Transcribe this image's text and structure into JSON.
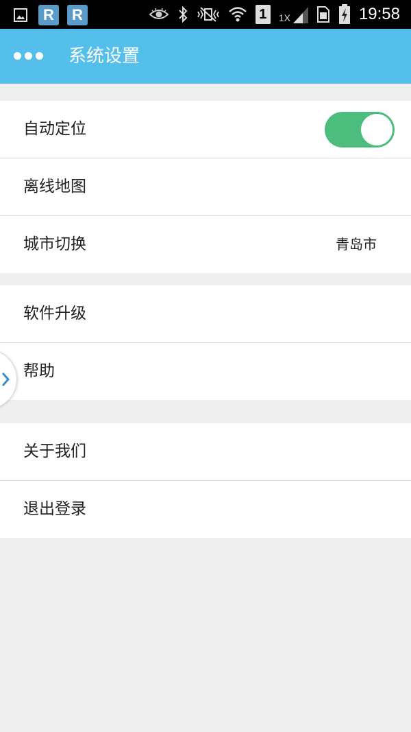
{
  "status_bar": {
    "time": "19:58",
    "sim_slot": "1",
    "network_label": "1X",
    "app_icon_letters": [
      "R",
      "R"
    ],
    "icons": [
      "gallery-icon",
      "r-app-icon",
      "eye-icon",
      "bluetooth-icon",
      "mute-vibrate-icon",
      "wifi-icon",
      "sim-icon",
      "signal-icon",
      "sim-card-icon",
      "battery-charging-icon"
    ]
  },
  "header": {
    "title": "系统设置",
    "menu_icon": "more-dots-icon"
  },
  "groups": [
    {
      "items": [
        {
          "label": "自动定位",
          "control": "toggle",
          "toggle_on": true
        },
        {
          "label": "离线地图"
        },
        {
          "label": "城市切换",
          "value": "青岛市"
        }
      ]
    },
    {
      "items": [
        {
          "label": "软件升级"
        },
        {
          "label": "帮助"
        }
      ]
    },
    {
      "items": [
        {
          "label": "关于我们"
        },
        {
          "label": "退出登录"
        }
      ]
    }
  ],
  "side_tab": {
    "icon": "chevron-right-icon"
  },
  "colors": {
    "header_bg": "#53bfea",
    "toggle_on": "#4cbd7c",
    "page_bg": "#efefef",
    "status_r_icon": "#5a9bc7",
    "chevron": "#3a8fc0"
  }
}
